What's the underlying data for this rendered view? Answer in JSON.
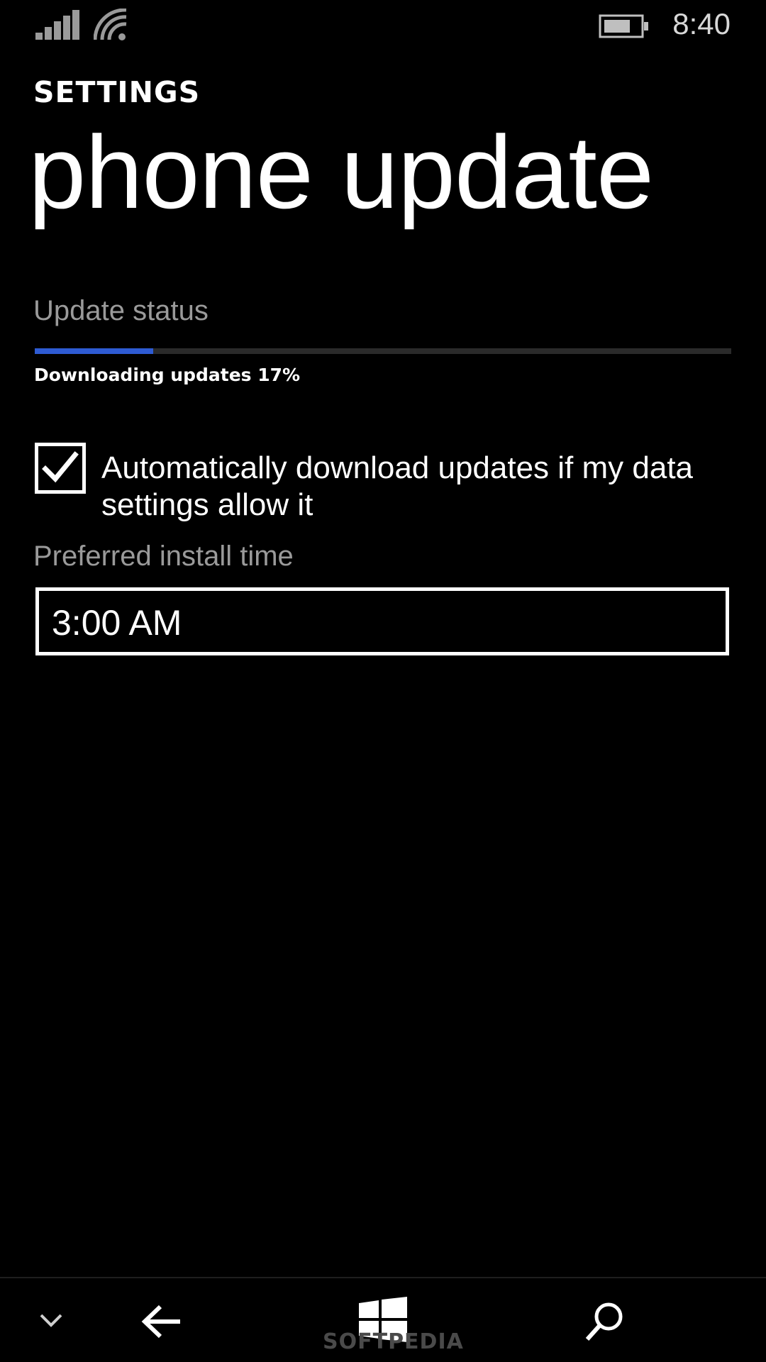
{
  "status_bar": {
    "time": "8:40",
    "icons": [
      "signal-icon",
      "wifi-icon",
      "battery-icon"
    ]
  },
  "header": {
    "section": "SETTINGS",
    "title": "phone update"
  },
  "update_status": {
    "label": "Update status",
    "progress_text": "Downloading updates 17%",
    "progress_percent": 17
  },
  "auto_download": {
    "label": "Automatically download updates if my data settings allow it",
    "checked": true
  },
  "install_time": {
    "label": "Preferred install time",
    "value": "3:00 AM"
  },
  "nav_bar": {
    "icons": [
      "chevron-down-icon",
      "back-arrow-icon",
      "windows-start-icon",
      "search-icon"
    ]
  },
  "watermark": "SOFTPEDIA",
  "colors": {
    "background": "#000000",
    "text": "#ffffff",
    "secondary_text": "#9a9a9a",
    "accent": "#2e5bd3"
  }
}
